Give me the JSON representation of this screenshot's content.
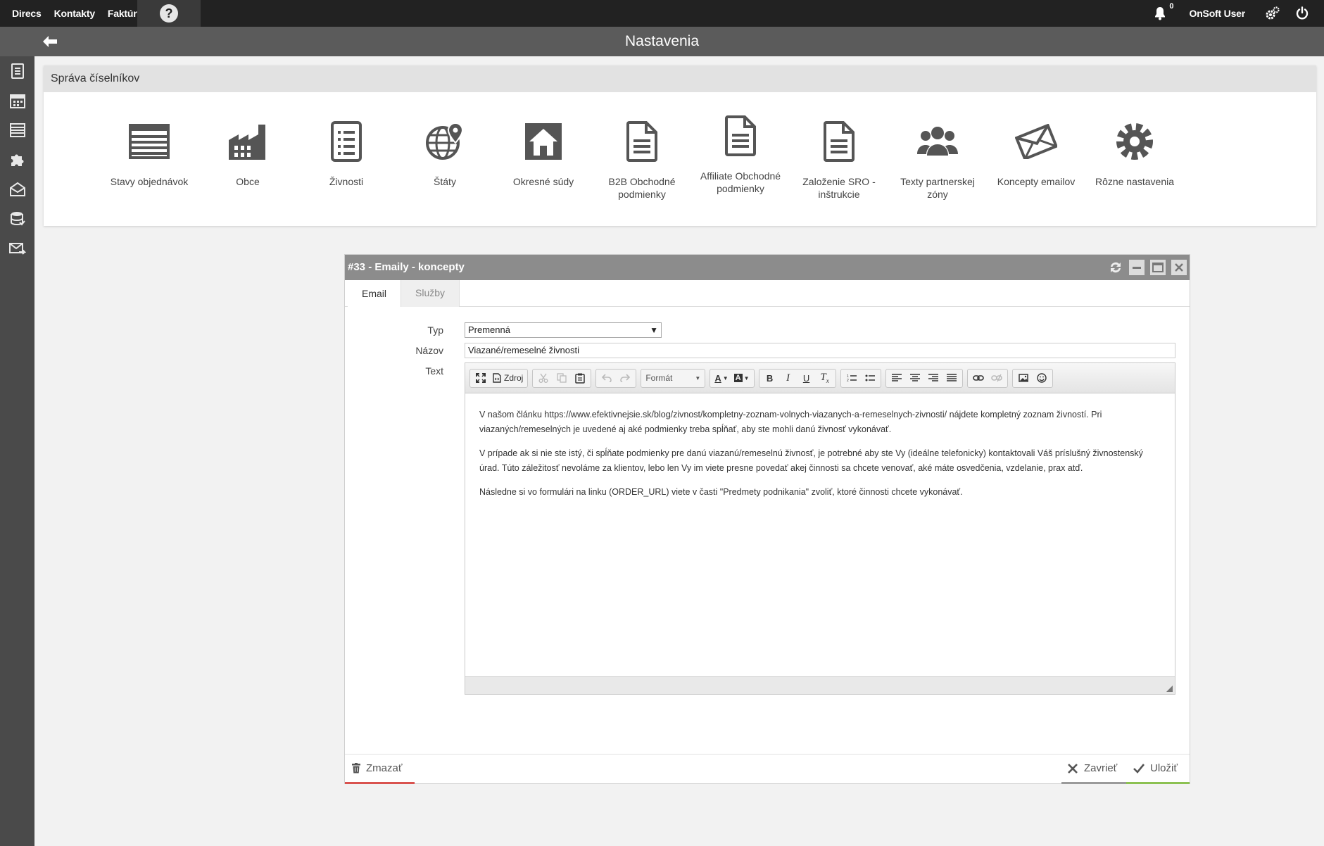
{
  "topbar": {
    "nav": [
      "Direcs",
      "Kontakty",
      "Faktúry"
    ],
    "help_label": "?",
    "notifications_count": "0",
    "user_name": "OnSoft User",
    "icons": [
      "bell-icon",
      "gears-icon",
      "power-icon"
    ]
  },
  "subheader": {
    "title": "Nastavenia",
    "back_icon": "arrow-left-icon"
  },
  "sidebar": {
    "items": [
      "document-icon",
      "calendar-icon",
      "list-icon",
      "puzzle-icon",
      "envelope-open-icon",
      "database-icon",
      "mail-forward-icon"
    ]
  },
  "panel": {
    "title": "Správa číselníkov",
    "tiles": [
      {
        "label": "Stavy objednávok",
        "icon": "list-icon"
      },
      {
        "label": "Obce",
        "icon": "factory-icon"
      },
      {
        "label": "Živnosti",
        "icon": "clipboard-list-icon"
      },
      {
        "label": "Štáty",
        "icon": "globe-pin-icon"
      },
      {
        "label": "Okresné súdy",
        "icon": "house-icon"
      },
      {
        "label": "B2B Obchodné podmienky",
        "icon": "document-icon"
      },
      {
        "label": "Affiliate Obchodné podmienky",
        "icon": "document-icon"
      },
      {
        "label": "Založenie SRO - inštrukcie",
        "icon": "document-icon"
      },
      {
        "label": "Texty partnerskej zóny",
        "icon": "users-icon"
      },
      {
        "label": "Koncepty emailov",
        "icon": "envelope-icon"
      },
      {
        "label": "Rôzne nastavenia",
        "icon": "gear-icon"
      }
    ]
  },
  "window": {
    "title": "#33 - Emaily - koncepty",
    "tabs": [
      "Email",
      "Služby"
    ],
    "active_tab": "Email",
    "form": {
      "type_label": "Typ",
      "type_value": "Premenná",
      "name_label": "Názov",
      "name_value": "Viazané/remeselné živnosti",
      "text_label": "Text"
    },
    "editor": {
      "source_label": "Zdroj",
      "format_label": "Formát",
      "paragraphs": [
        "V našom článku https://www.efektivnejsie.sk/blog/zivnost/kompletny-zoznam-volnych-viazanych-a-remeselnych-zivnosti/ nájdete kompletný zoznam živností. Pri viazaných/remeselných je uvedené aj aké podmienky treba spĺňať, aby ste mohli danú živnosť vykonávať.",
        "V prípade ak si nie ste istý, či spĺňate podmienky pre danú viazanú/remeselnú živnosť, je potrebné aby ste Vy (ideálne telefonicky) kontaktovali Váš príslušný živnostenský úrad. Túto záležitosť nevoláme za klientov, lebo len Vy im viete presne povedať akej činnosti sa chcete venovať, aké máte osvedčenia, vzdelanie, prax atď.",
        "Následne si vo formulári na linku (ORDER_URL) viete v časti \"Predmety podnikania\" zvoliť, ktoré činnosti chcete vykonávať."
      ]
    },
    "footer": {
      "delete_label": "Zmazať",
      "close_label": "Zavrieť",
      "save_label": "Uložiť"
    }
  },
  "colors": {
    "topbar": "#222222",
    "subheader": "#5b5b5b",
    "sidebar": "#4a4a4a",
    "window_title": "#8c8c8c",
    "delete_accent": "#d9534f",
    "save_accent": "#8cc152"
  }
}
